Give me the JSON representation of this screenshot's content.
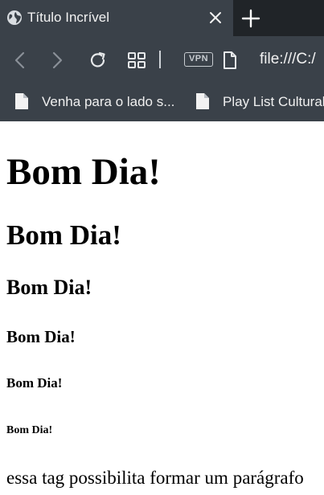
{
  "browser": {
    "tab": {
      "title": "Título Incrível"
    },
    "toolbar": {
      "vpn_label": "VPN",
      "url": "file:///C:/"
    },
    "bookmarks": [
      {
        "label": "Venha para o lado s..."
      },
      {
        "label": "Play List Cultural"
      }
    ],
    "colors": {
      "frame": "#3a4149",
      "tabstrip": "#202428",
      "text": "#f2f2f2",
      "icon": "#cfd3d8",
      "disabled_icon": "#8a9098"
    }
  },
  "page": {
    "headings": [
      "Bom Dia!",
      "Bom Dia!",
      "Bom Dia!",
      "Bom Dia!",
      "Bom Dia!",
      "Bom Dia!"
    ],
    "paragraph": "essa tag possibilita formar um parágrafo"
  }
}
